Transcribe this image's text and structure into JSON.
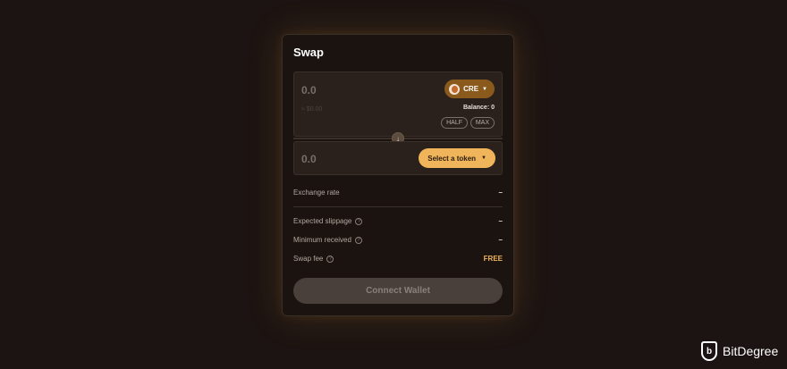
{
  "swap": {
    "title": "Swap",
    "from": {
      "amount": "0.0",
      "usd_value": "≈ $0.00",
      "token": "CRE",
      "balance": "Balance: 0",
      "half_label": "HALF",
      "max_label": "MAX"
    },
    "to": {
      "amount": "0.0",
      "select_label": "Select a token"
    },
    "switch_icon": "↓",
    "details": {
      "exchange_rate_label": "Exchange rate",
      "exchange_rate_value": "–",
      "slippage_label": "Expected slippage",
      "slippage_value": "–",
      "min_received_label": "Minimum received",
      "min_received_value": "–",
      "fee_label": "Swap fee",
      "fee_value": "FREE",
      "help_glyph": "?"
    },
    "connect_label": "Connect Wallet"
  },
  "brand": {
    "name": "BitDegree",
    "logo_letter": "b"
  },
  "colors": {
    "background": "#1c1412",
    "accent": "#f0b55a",
    "token_pill": "#8a5a1c"
  }
}
